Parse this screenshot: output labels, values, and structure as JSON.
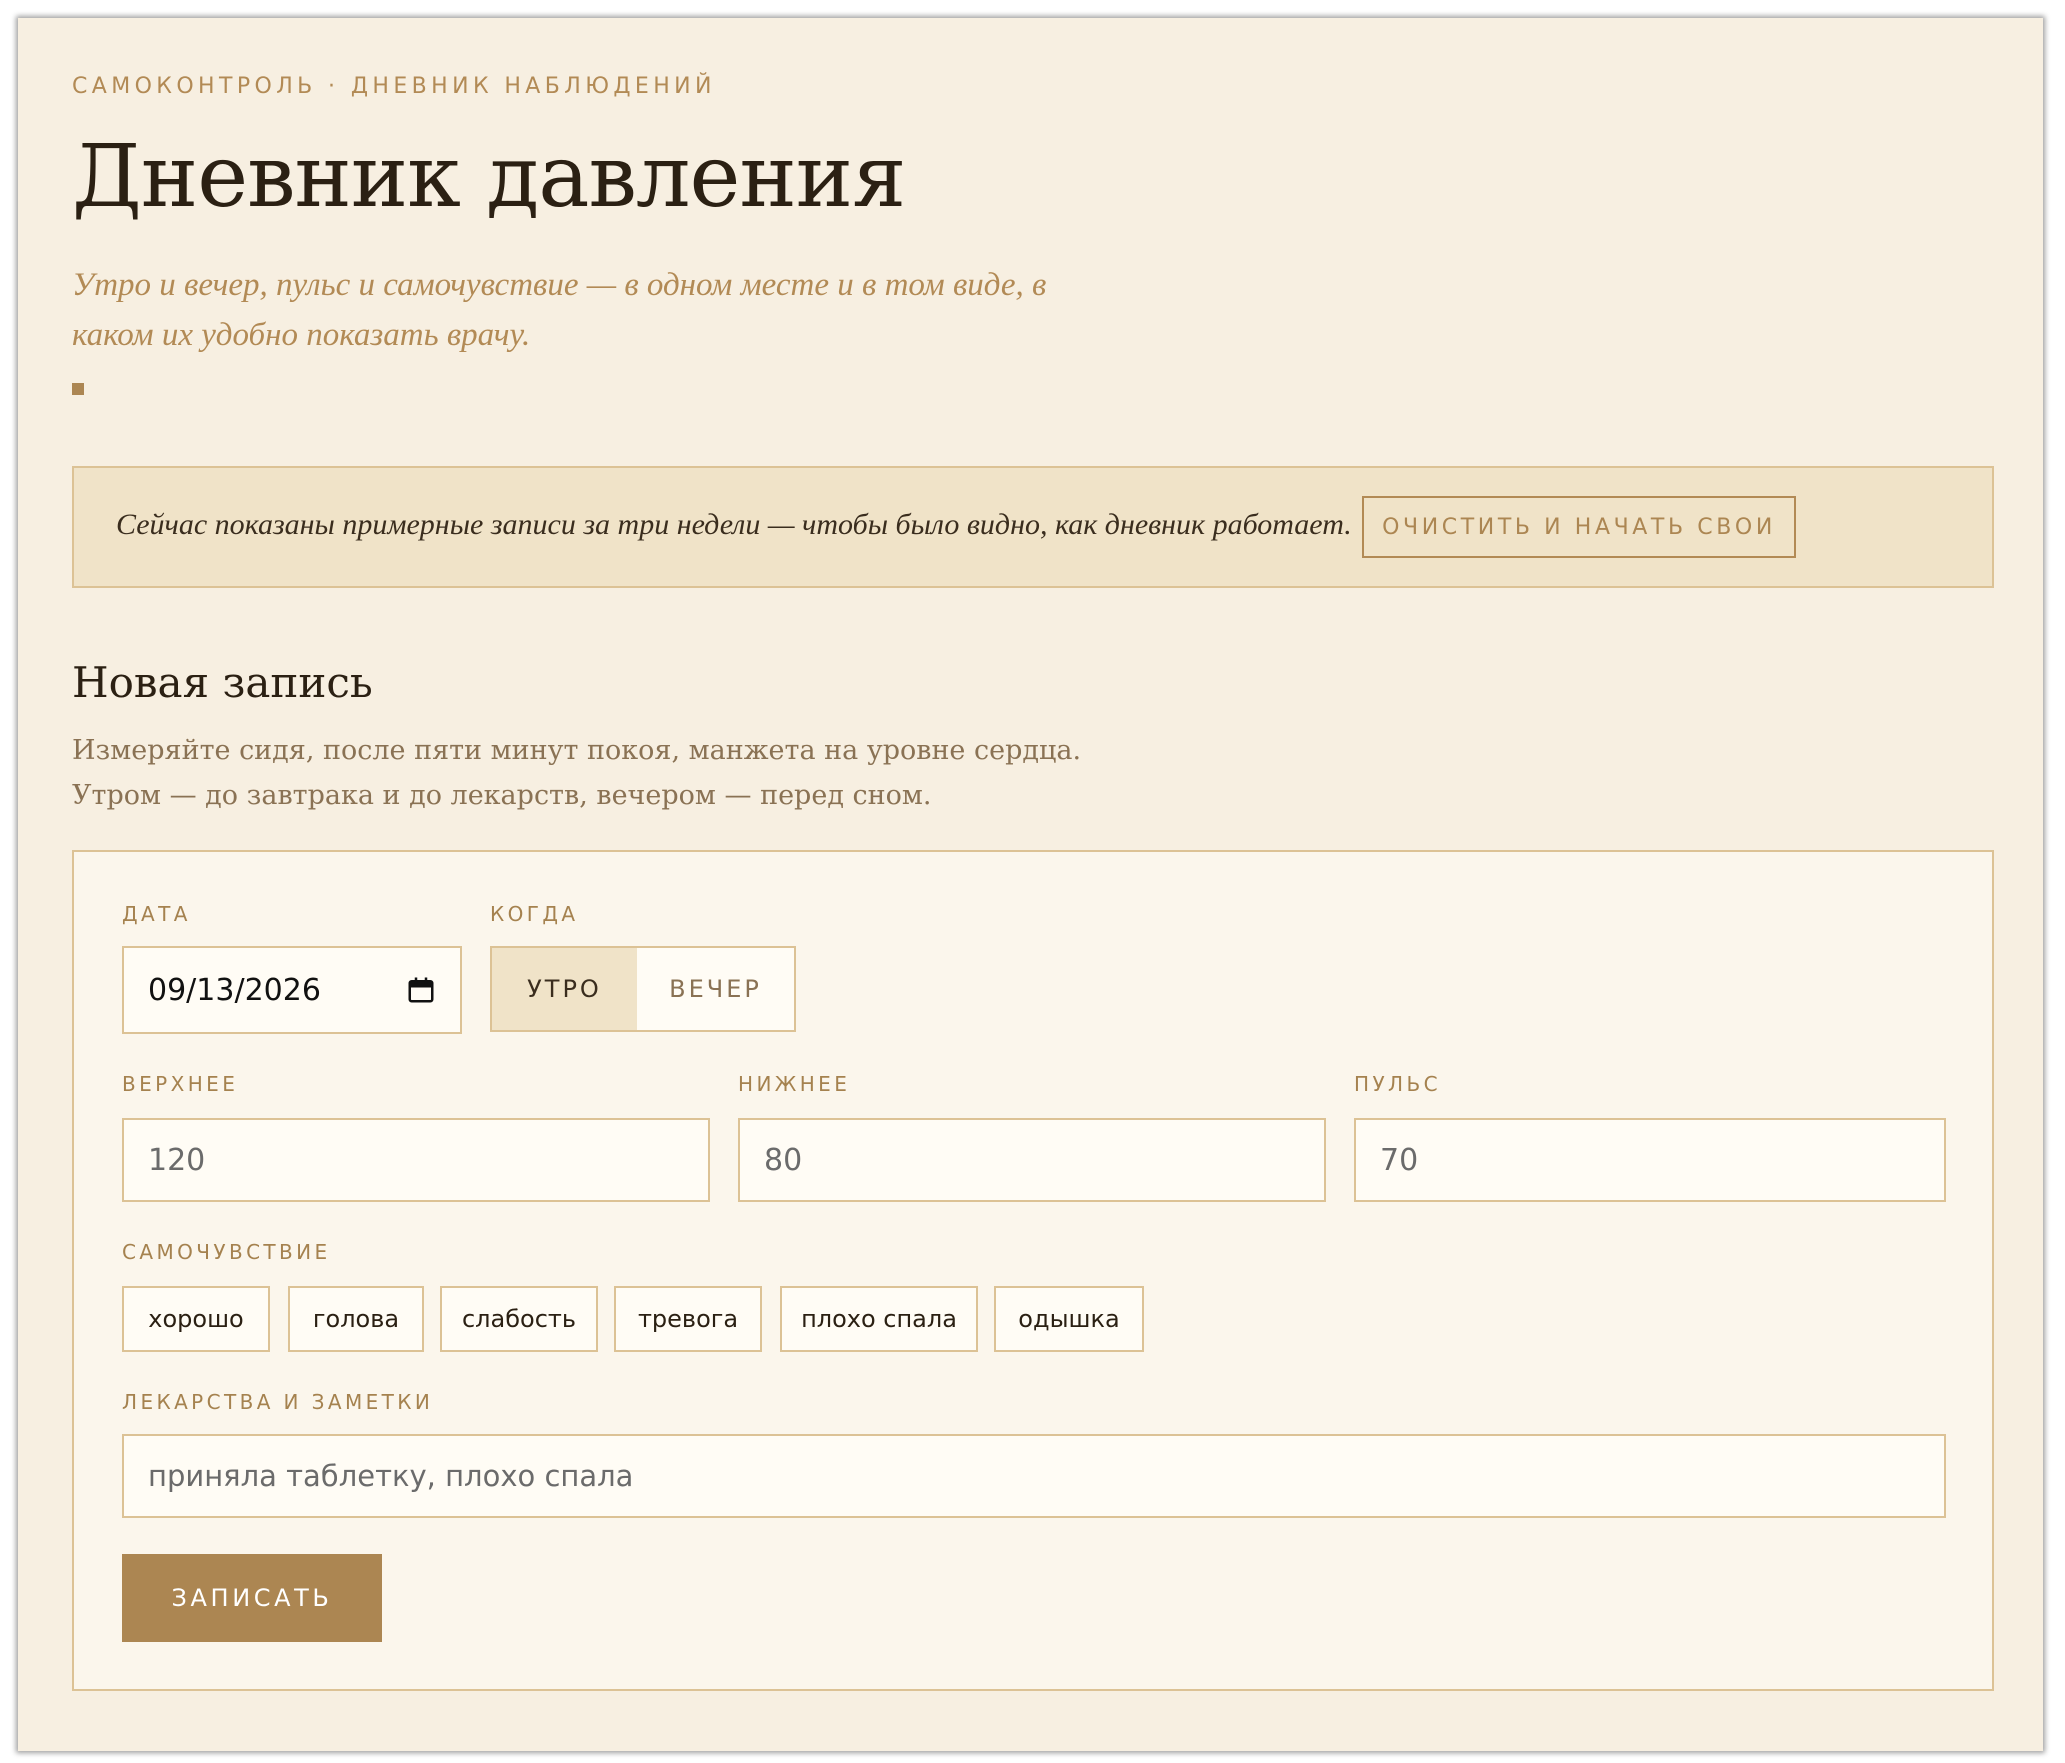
{
  "header": {
    "eyebrow": "САМОКОНТРОЛЬ · ДНЕВНИК НАБЛЮДЕНИЙ",
    "title": "Дневник давления",
    "subtitle_line1": "Утро и вечер, пульс и самочувствие — в одном месте и в том виде, в",
    "subtitle_line2": "каком их удобно показать врачу."
  },
  "notice": {
    "text": "Сейчас показаны примерные записи за три недели — чтобы было видно, как дневник работает.",
    "clear_button": "ОЧИСТИТЬ И НАЧАТЬ СВОИ"
  },
  "new_entry": {
    "title": "Новая запись",
    "hint_line1": "Измеряйте сидя, после пяти минут покоя, манжета на уровне сердца.",
    "hint_line2": "Утром — до завтрака и до лекарств, вечером — перед сном.",
    "date_label": "ДАТА",
    "date_value": "09/13/2026",
    "when_label": "КОГДА",
    "when_options": [
      "УТРО",
      "ВЕЧЕР"
    ],
    "when_selected": "УТРО",
    "systolic_label": "ВЕРХНЕЕ",
    "systolic_placeholder": "120",
    "diastolic_label": "НИЖНЕЕ",
    "diastolic_placeholder": "80",
    "pulse_label": "ПУЛЬС",
    "pulse_placeholder": "70",
    "wellbeing_label": "САМОЧУВСТВИЕ",
    "wellbeing_tags": [
      "хорошо",
      "голова",
      "слабость",
      "тревога",
      "плохо спала",
      "одышка"
    ],
    "notes_label": "ЛЕКАРСТВА И ЗАМЕТКИ",
    "notes_placeholder": "приняла таблетку, плохо спала",
    "submit_label": "ЗАПИСАТЬ"
  },
  "icons": {
    "date": "calendar-icon",
    "accent_mark": "square-bullet"
  },
  "colors": {
    "background": "#f7efe1",
    "accent": "#ac8652",
    "notice_bg": "#f0e3c8",
    "border": "#dcc295",
    "text_dark": "#2b2013"
  }
}
